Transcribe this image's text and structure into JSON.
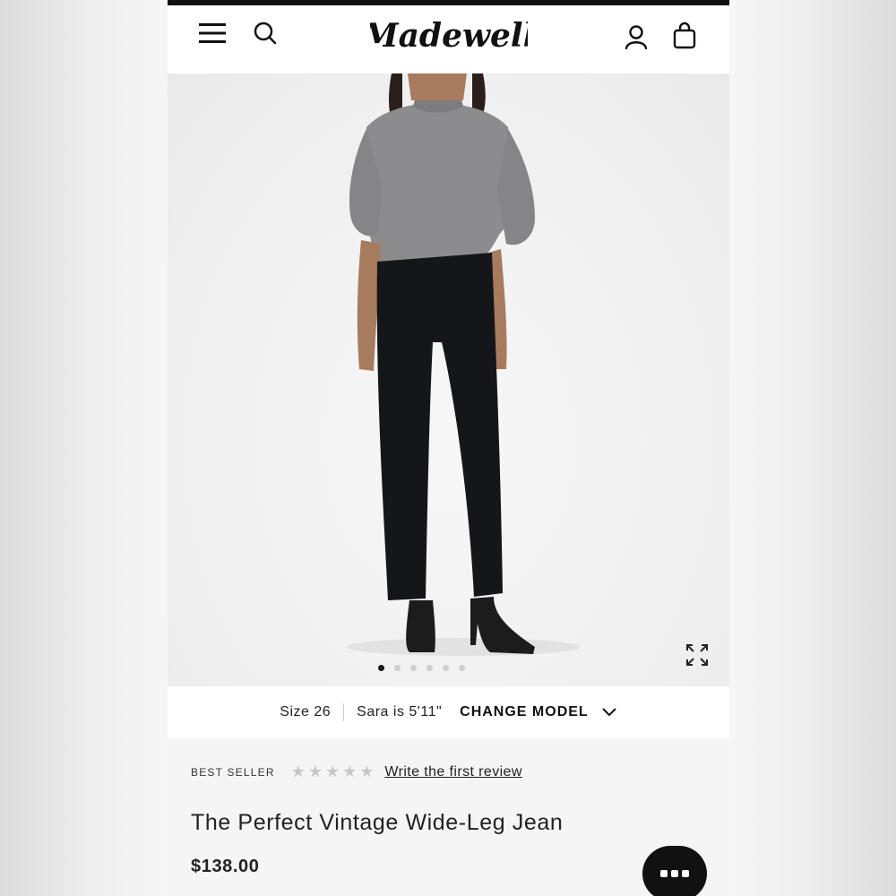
{
  "header": {
    "brand": "Madewell",
    "icons": {
      "menu": "menu-icon",
      "search": "search-icon",
      "account": "account-icon",
      "bag": "shopping-bag-icon"
    }
  },
  "gallery": {
    "image_count": 6,
    "active_index": 0,
    "expand_icon": "expand-icon"
  },
  "model_info": {
    "size": "Size 26",
    "model": "Sara is 5'11\"",
    "change_label": "CHANGE MODEL"
  },
  "product": {
    "badge": "BEST SELLER",
    "rating": 0,
    "max_rating": 5,
    "review_link": "Write the first review",
    "title": "The Perfect Vintage Wide-Leg Jean",
    "price": "$138.00"
  },
  "chat": {
    "icon": "chat-icon"
  },
  "colors": {
    "text": "#222222",
    "star_empty": "#c7c7c7",
    "chat_bg": "#111111"
  }
}
